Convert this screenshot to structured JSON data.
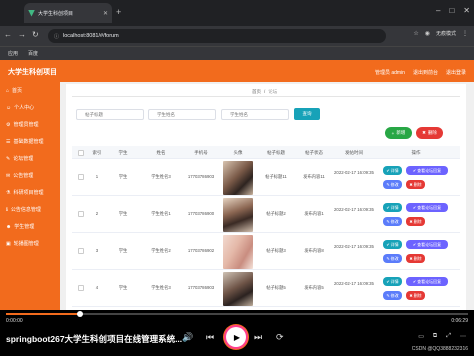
{
  "browser": {
    "tab_title": "大学生科创项目",
    "url": "localhost:8081/#/forum",
    "profile": "无痕模式",
    "bookmarks": [
      "应用",
      "百度"
    ]
  },
  "app": {
    "title": "大学生科创项目",
    "header_links": [
      "管理员 admin",
      "退出到前台",
      "退出登录"
    ],
    "accent": "#f26b1d"
  },
  "sidebar": {
    "items": [
      "首页",
      "个人中心",
      "管理员管理",
      "基础数据管理",
      "论坛管理",
      "公告管理",
      "科研项目管理",
      "公告信息管理",
      "学生管理",
      "轮播图管理"
    ]
  },
  "breadcrumb": {
    "home": "首页",
    "current": "论坛"
  },
  "search": {
    "placeholders": [
      "帖子标题",
      "学生姓名",
      "学生姓名"
    ],
    "button": "查询"
  },
  "actions": {
    "add": "新增",
    "delete": "删除"
  },
  "table": {
    "headers": [
      "索引",
      "学生",
      "姓名",
      "手机号",
      "头像",
      "帖子标题",
      "帖子状态",
      "发帖时间",
      "操作"
    ],
    "rows": [
      {
        "index": "1",
        "student": "学生",
        "name": "学生姓名3",
        "phone": "17703786903",
        "title": "帖子标题11",
        "status": "发布内容11",
        "time": "2022-02-17 16:09:35",
        "thumb": "a"
      },
      {
        "index": "2",
        "student": "学生",
        "name": "学生姓名1",
        "phone": "17703786900",
        "title": "帖子标题2",
        "status": "发布内容1",
        "time": "2022-02-17 16:09:35",
        "thumb": "b"
      },
      {
        "index": "3",
        "student": "学生",
        "name": "学生姓名2",
        "phone": "17703786902",
        "title": "帖子标题3",
        "status": "发布内容8",
        "time": "2022-02-17 16:09:35",
        "thumb": "c"
      },
      {
        "index": "4",
        "student": "学生",
        "name": "学生姓名3",
        "phone": "17703786903",
        "title": "帖子标题5",
        "status": "发布内容5",
        "time": "2022-02-17 16:09:35",
        "thumb": "d"
      }
    ],
    "row_actions": {
      "detail": "详情",
      "view_reply": "查看论坛回复",
      "edit": "修改",
      "delete": "删除"
    }
  },
  "player": {
    "current_time": "0:00:00",
    "total_time": "0:06:29",
    "progress": 0.16,
    "video_title": "springboot267大学生科创项目在线管理系统...",
    "watermark": "CSDN @QQ3888232316"
  }
}
